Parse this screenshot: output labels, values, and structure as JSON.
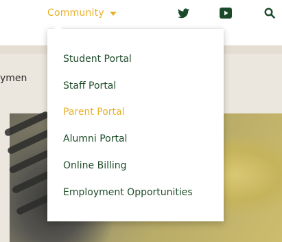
{
  "nav": {
    "community_label": "Community"
  },
  "icons": {
    "twitter": "twitter-icon",
    "youtube": "youtube-icon",
    "search": "search-icon"
  },
  "background": {
    "partial_heading": "ymen"
  },
  "menu": {
    "items": [
      {
        "label": "Student Portal",
        "active": false
      },
      {
        "label": "Staff Portal",
        "active": false
      },
      {
        "label": "Parent Portal",
        "active": true
      },
      {
        "label": "Alumni Portal",
        "active": false
      },
      {
        "label": "Online Billing",
        "active": false
      },
      {
        "label": "Employment Opportunities",
        "active": false
      }
    ]
  },
  "colors": {
    "accent": "#e9b128",
    "brand_green": "#1f4d2b",
    "icon_green": "#1b4a2a"
  }
}
